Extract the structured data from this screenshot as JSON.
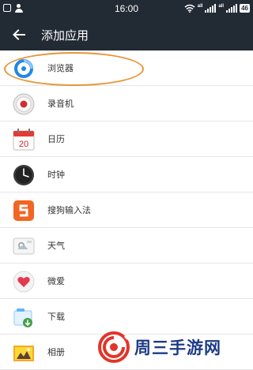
{
  "status_bar": {
    "time": "16:00",
    "signal_1_label": "all",
    "signal_2_label": "all",
    "battery": "46",
    "icons": [
      "notification-box-icon",
      "person-icon",
      "wifi-icon",
      "signal-icon",
      "battery-icon"
    ]
  },
  "toolbar": {
    "back_icon": "arrow-left-icon",
    "title": "添加应用"
  },
  "apps": [
    {
      "label": "浏览器",
      "icon": "browser-icon"
    },
    {
      "label": "录音机",
      "icon": "recorder-icon"
    },
    {
      "label": "日历",
      "icon": "calendar-icon",
      "icon_text": "20"
    },
    {
      "label": "时钟",
      "icon": "clock-icon"
    },
    {
      "label": "搜狗输入法",
      "icon": "sogou-input-icon"
    },
    {
      "label": "天气",
      "icon": "weather-icon"
    },
    {
      "label": "微爱",
      "icon": "heart-icon"
    },
    {
      "label": "下载",
      "icon": "download-icon"
    },
    {
      "label": "相册",
      "icon": "gallery-icon"
    }
  ],
  "colors": {
    "toolbar_bg": "#222a33",
    "highlight_ring": "#e8953a",
    "watermark_red": "#e3342a",
    "watermark_blue": "#1d3b86"
  },
  "watermark": {
    "text": "周三手游网",
    "logo": "swirl-logo"
  }
}
